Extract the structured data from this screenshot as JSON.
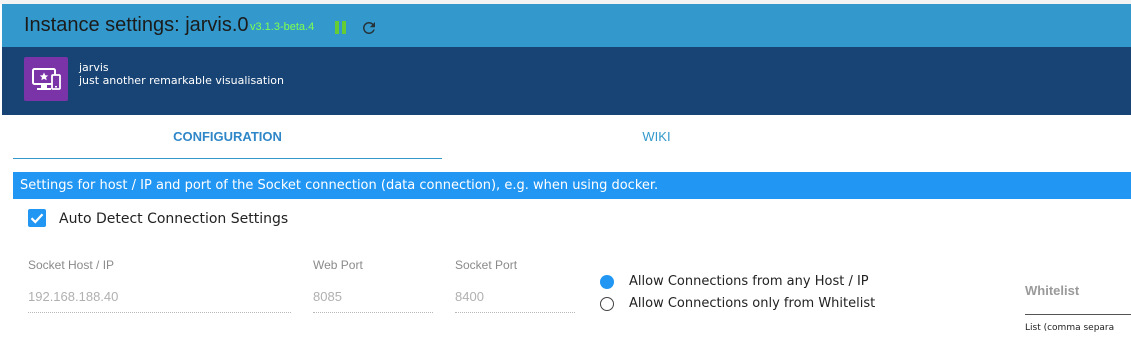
{
  "window": {
    "title": "Instance settings: jarvis.0",
    "version": "v3.1.3-beta.4",
    "colors": {
      "titlebar": "#3399cc",
      "header": "#174475",
      "accent": "#2196f3",
      "version": "#7fff4f",
      "pause": "#66cc33",
      "logo": "#7b33a8"
    },
    "icons": {
      "pause": "pause-icon",
      "reload": "reload-icon",
      "logo": "monitor-star-icon"
    }
  },
  "app": {
    "name": "jarvis",
    "description": "just another remarkable visualisation"
  },
  "tabs": [
    {
      "label": "CONFIGURATION",
      "active": true
    },
    {
      "label": "WIKI",
      "active": false
    }
  ],
  "info": {
    "text": "Settings for host / IP and port of the Socket connection (data connection), e.g. when using docker."
  },
  "auto_detect": {
    "label": "Auto Detect Connection Settings",
    "checked": true
  },
  "fields": {
    "socket_host": {
      "label": "Socket Host / IP",
      "value": "192.168.188.40"
    },
    "web_port": {
      "label": "Web Port",
      "value": "8085"
    },
    "socket_port": {
      "label": "Socket Port",
      "value": "8400"
    }
  },
  "connections": [
    {
      "label": "Allow Connections from any Host / IP",
      "selected": true
    },
    {
      "label": "Allow Connections only from Whitelist",
      "selected": false
    }
  ],
  "whitelist": {
    "label": "Whitelist",
    "hint": "List (comma separa"
  }
}
